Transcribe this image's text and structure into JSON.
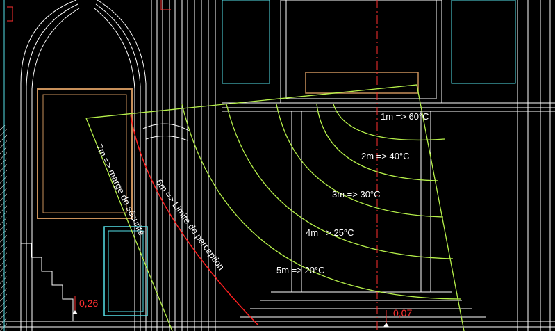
{
  "colors": {
    "background": "#000000",
    "architecture": "#ffffff",
    "frame_cyan": "#55e0e8",
    "frame_tan": "#c8905a",
    "heat_zone": "#b6f04a",
    "perception_line": "#ff2020",
    "axis_line": "#ff3030",
    "dimension_text": "#ff3030"
  },
  "heat_zones": [
    {
      "label": "1m => 60°C"
    },
    {
      "label": "2m => 40°C"
    },
    {
      "label": "3m => 30°C"
    },
    {
      "label": "4m => 25°C"
    },
    {
      "label": "5m => 20°C"
    }
  ],
  "arc_labels": {
    "safety_margin": "7m => marge de sécurité",
    "perception_limit": "6m => Limite de perception"
  },
  "dimensions": {
    "left": "0,26",
    "right": "0,07"
  }
}
